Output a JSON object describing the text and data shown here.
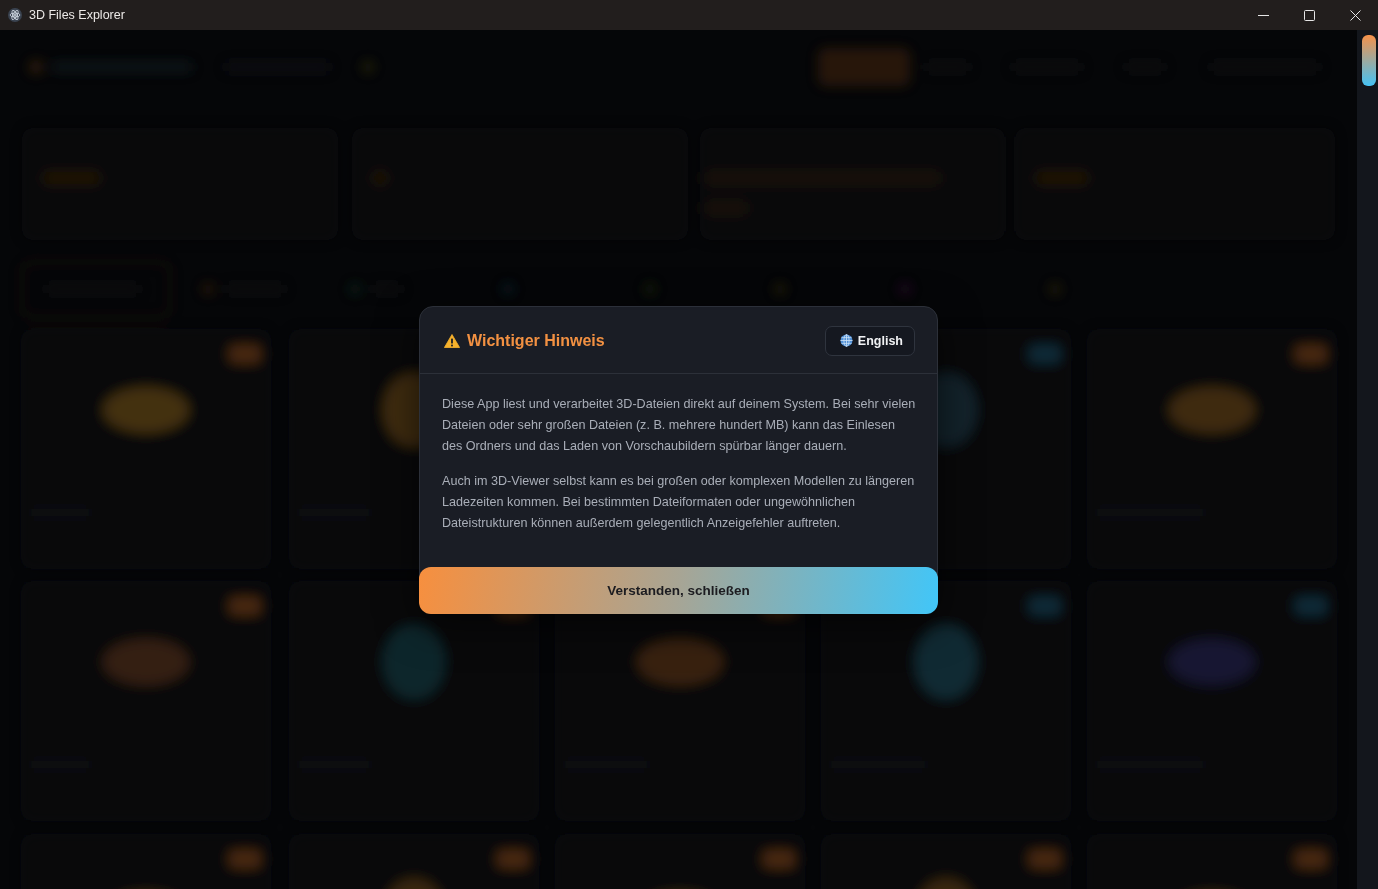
{
  "window": {
    "title": "3D Files Explorer"
  },
  "dialog": {
    "title": "Wichtiger Hinweis",
    "language_button": "English",
    "paragraphs": [
      "Diese App liest und verarbeitet 3D-Dateien direkt auf deinem System. Bei sehr vielen Dateien oder sehr großen Dateien (z. B. mehrere hundert MB) kann das Einlesen des Ordners und das Laden von Vorschaubildern spürbar länger dauern.",
      "Auch im 3D-Viewer selbst kann es bei großen oder komplexen Modellen zu längeren Ladezeiten kommen. Bei bestimmten Dateiformaten oder ungewöhnlichen Dateistrukturen können außerdem gelegentlich Anzeigefehler auftreten."
    ],
    "confirm_button": "Verstanden, schließen"
  }
}
